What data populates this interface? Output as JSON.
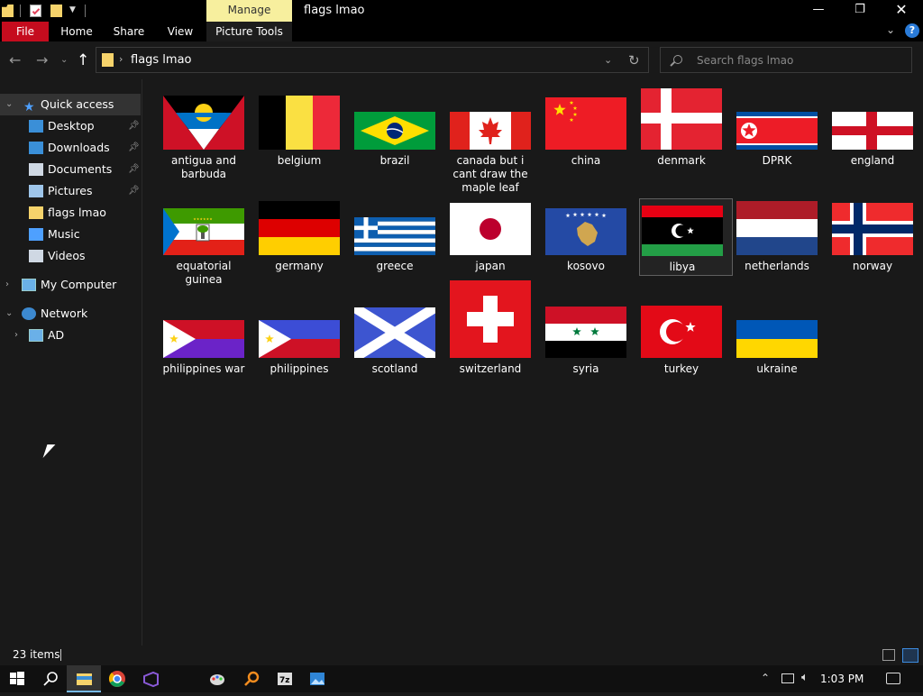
{
  "window": {
    "title": "flags lmao",
    "manage_tab": "Manage",
    "picture_tools": "Picture Tools",
    "minimize": "—",
    "maximize": "❐",
    "close": "✕"
  },
  "ribbon": {
    "tabs": [
      "File",
      "Home",
      "Share",
      "View"
    ],
    "help": "?"
  },
  "nav": {
    "path": "flags lmao",
    "search_placeholder": "Search flags lmao"
  },
  "sidebar": {
    "quick_access": "Quick access",
    "items": [
      {
        "label": "Desktop",
        "pinned": true,
        "icon": "desktop-icon"
      },
      {
        "label": "Downloads",
        "pinned": true,
        "icon": "downloads-icon"
      },
      {
        "label": "Documents",
        "pinned": true,
        "icon": "documents-icon"
      },
      {
        "label": "Pictures",
        "pinned": true,
        "icon": "pictures-icon"
      },
      {
        "label": "flags lmao",
        "pinned": false,
        "icon": "folder-icon"
      },
      {
        "label": "Music",
        "pinned": false,
        "icon": "music-icon"
      },
      {
        "label": "Videos",
        "pinned": false,
        "icon": "videos-icon"
      }
    ],
    "my_computer": "My Computer",
    "network": "Network",
    "ad": "AD"
  },
  "files": [
    {
      "name": "antigua and barbuda",
      "flag": "antigua"
    },
    {
      "name": "belgium",
      "flag": "belgium"
    },
    {
      "name": "brazil",
      "flag": "brazil"
    },
    {
      "name": "canada but i cant draw the maple leaf",
      "flag": "canada"
    },
    {
      "name": "china",
      "flag": "china"
    },
    {
      "name": "denmark",
      "flag": "denmark"
    },
    {
      "name": "DPRK",
      "flag": "dprk"
    },
    {
      "name": "england",
      "flag": "england"
    },
    {
      "name": "equatorial guinea",
      "flag": "eqguinea"
    },
    {
      "name": "germany",
      "flag": "germany"
    },
    {
      "name": "greece",
      "flag": "greece"
    },
    {
      "name": "japan",
      "flag": "japan"
    },
    {
      "name": "kosovo",
      "flag": "kosovo"
    },
    {
      "name": "libya",
      "flag": "libya"
    },
    {
      "name": "netherlands",
      "flag": "netherlands"
    },
    {
      "name": "norway",
      "flag": "norway"
    },
    {
      "name": "philippines war",
      "flag": "philwar"
    },
    {
      "name": "philippines",
      "flag": "phil"
    },
    {
      "name": "scotland",
      "flag": "scotland"
    },
    {
      "name": "switzerland",
      "flag": "switzerland"
    },
    {
      "name": "syria",
      "flag": "syria"
    },
    {
      "name": "turkey",
      "flag": "turkey"
    },
    {
      "name": "ukraine",
      "flag": "ukraine"
    }
  ],
  "selected_file": "libya",
  "status": {
    "count": "23 items"
  },
  "taskbar": {
    "clock": "1:03 PM",
    "apps": [
      "windows-start-icon",
      "search-icon",
      "file-explorer-icon",
      "chrome-icon",
      "visual-studio-icon",
      "paint-icon",
      "search-app-icon",
      "7zip-icon",
      "photos-icon"
    ]
  },
  "colors": {
    "file_tab": "#c50c1e",
    "manage_tab": "#f7ef9e",
    "accent": "#3d8ce0"
  }
}
